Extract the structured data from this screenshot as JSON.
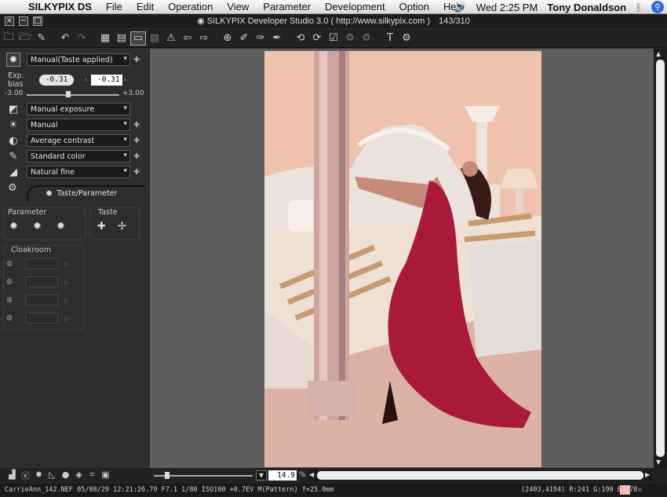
{
  "menubar": {
    "app_name": "SILKYPIX DS",
    "menus": [
      "File",
      "Edit",
      "Operation",
      "View",
      "Parameter",
      "Development",
      "Option",
      "Help"
    ],
    "clock": "Wed 2:25 PM",
    "user": "Tony Donaldson"
  },
  "window": {
    "title": "SILKYPIX Developer Studio 3.0 ( http://www.silkypix.com )",
    "counter": "143/310"
  },
  "panel": {
    "taste": "Manual(Taste applied)",
    "exp_bias_label": "Exp. bias",
    "exp_bias_value": "-0.31",
    "exp_bias_input": "-0.31",
    "range_min": "-3.00",
    "range_max": "+3.00",
    "exposure_mode": "Manual exposure",
    "white_balance": "Manual",
    "contrast": "Average contrast",
    "color": "Standard color",
    "sharpness": "Natural fine",
    "tab_label": "Taste/Parameter",
    "parameter_group": "Parameter",
    "taste_group": "Taste",
    "cloakroom": "Cloakroom"
  },
  "bottom": {
    "zoom_value": "14.9",
    "zoom_unit": "%"
  },
  "status": {
    "file_info": "CarrieAnn_142.NEF 05/08/29 12:21:26.79 F7.1 1/80 ISO100 +0.7EV M(Pattern) f=25.0mm",
    "pixel_info": "(2403,4194) R:241 G:190 B:178",
    "swatch_color": "#f1beb2"
  }
}
